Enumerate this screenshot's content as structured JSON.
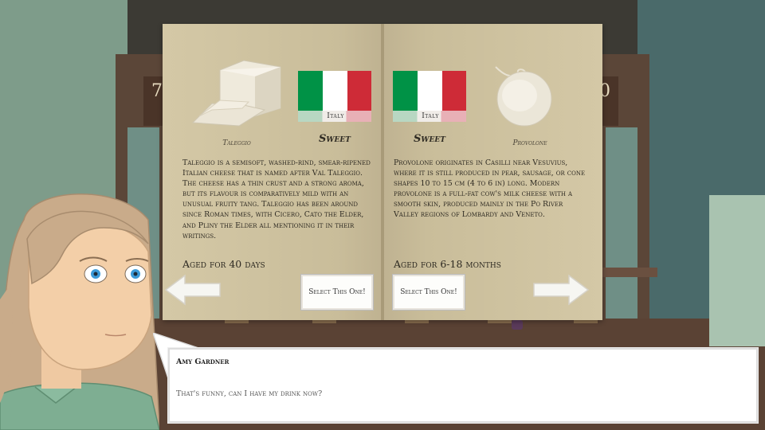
{
  "scene": {
    "menu_number_left": "7",
    "menu_number_right": "0"
  },
  "left_page": {
    "cheese_name": "Taleggio",
    "country": "Italy",
    "flavor": "Sweet",
    "description": "Taleggio is a semisoft, washed-rind, smear-ripened Italian cheese that is named after Val Taleggio. The cheese has a thin crust and a strong aroma, but its flavour is comparatively mild with an unusual fruity tang. Taleggio has been around since Roman times, with Cicero, Cato the Elder, and Pliny the Elder all mentioning it in their writings.",
    "aged": "Aged for 40 days",
    "select_label": "Select This One!"
  },
  "right_page": {
    "cheese_name": "Provolone",
    "country": "Italy",
    "flavor": "Sweet",
    "description": "Provolone originates in Casilli near Vesuvius, where it is still produced in pear, sausage, or cone shapes 10 to 15 cm (4 to 6 in) long. Modern provolone is a full-fat cow's milk cheese with a smooth skin, produced mainly in the Po River Valley regions of Lombardy and Veneto.",
    "aged": "Aged for 6-18 months",
    "select_label": "Select This One!"
  },
  "nav": {
    "prev_icon": "arrow-left-icon",
    "next_icon": "arrow-right-icon"
  },
  "dialog": {
    "speaker": "Amy Gardner",
    "text": "That's funny, can I have my drink now?"
  },
  "colors": {
    "flag_green": "#009246",
    "flag_white": "#ffffff",
    "flag_red": "#ce2b37",
    "page": "#cbbf9c"
  }
}
